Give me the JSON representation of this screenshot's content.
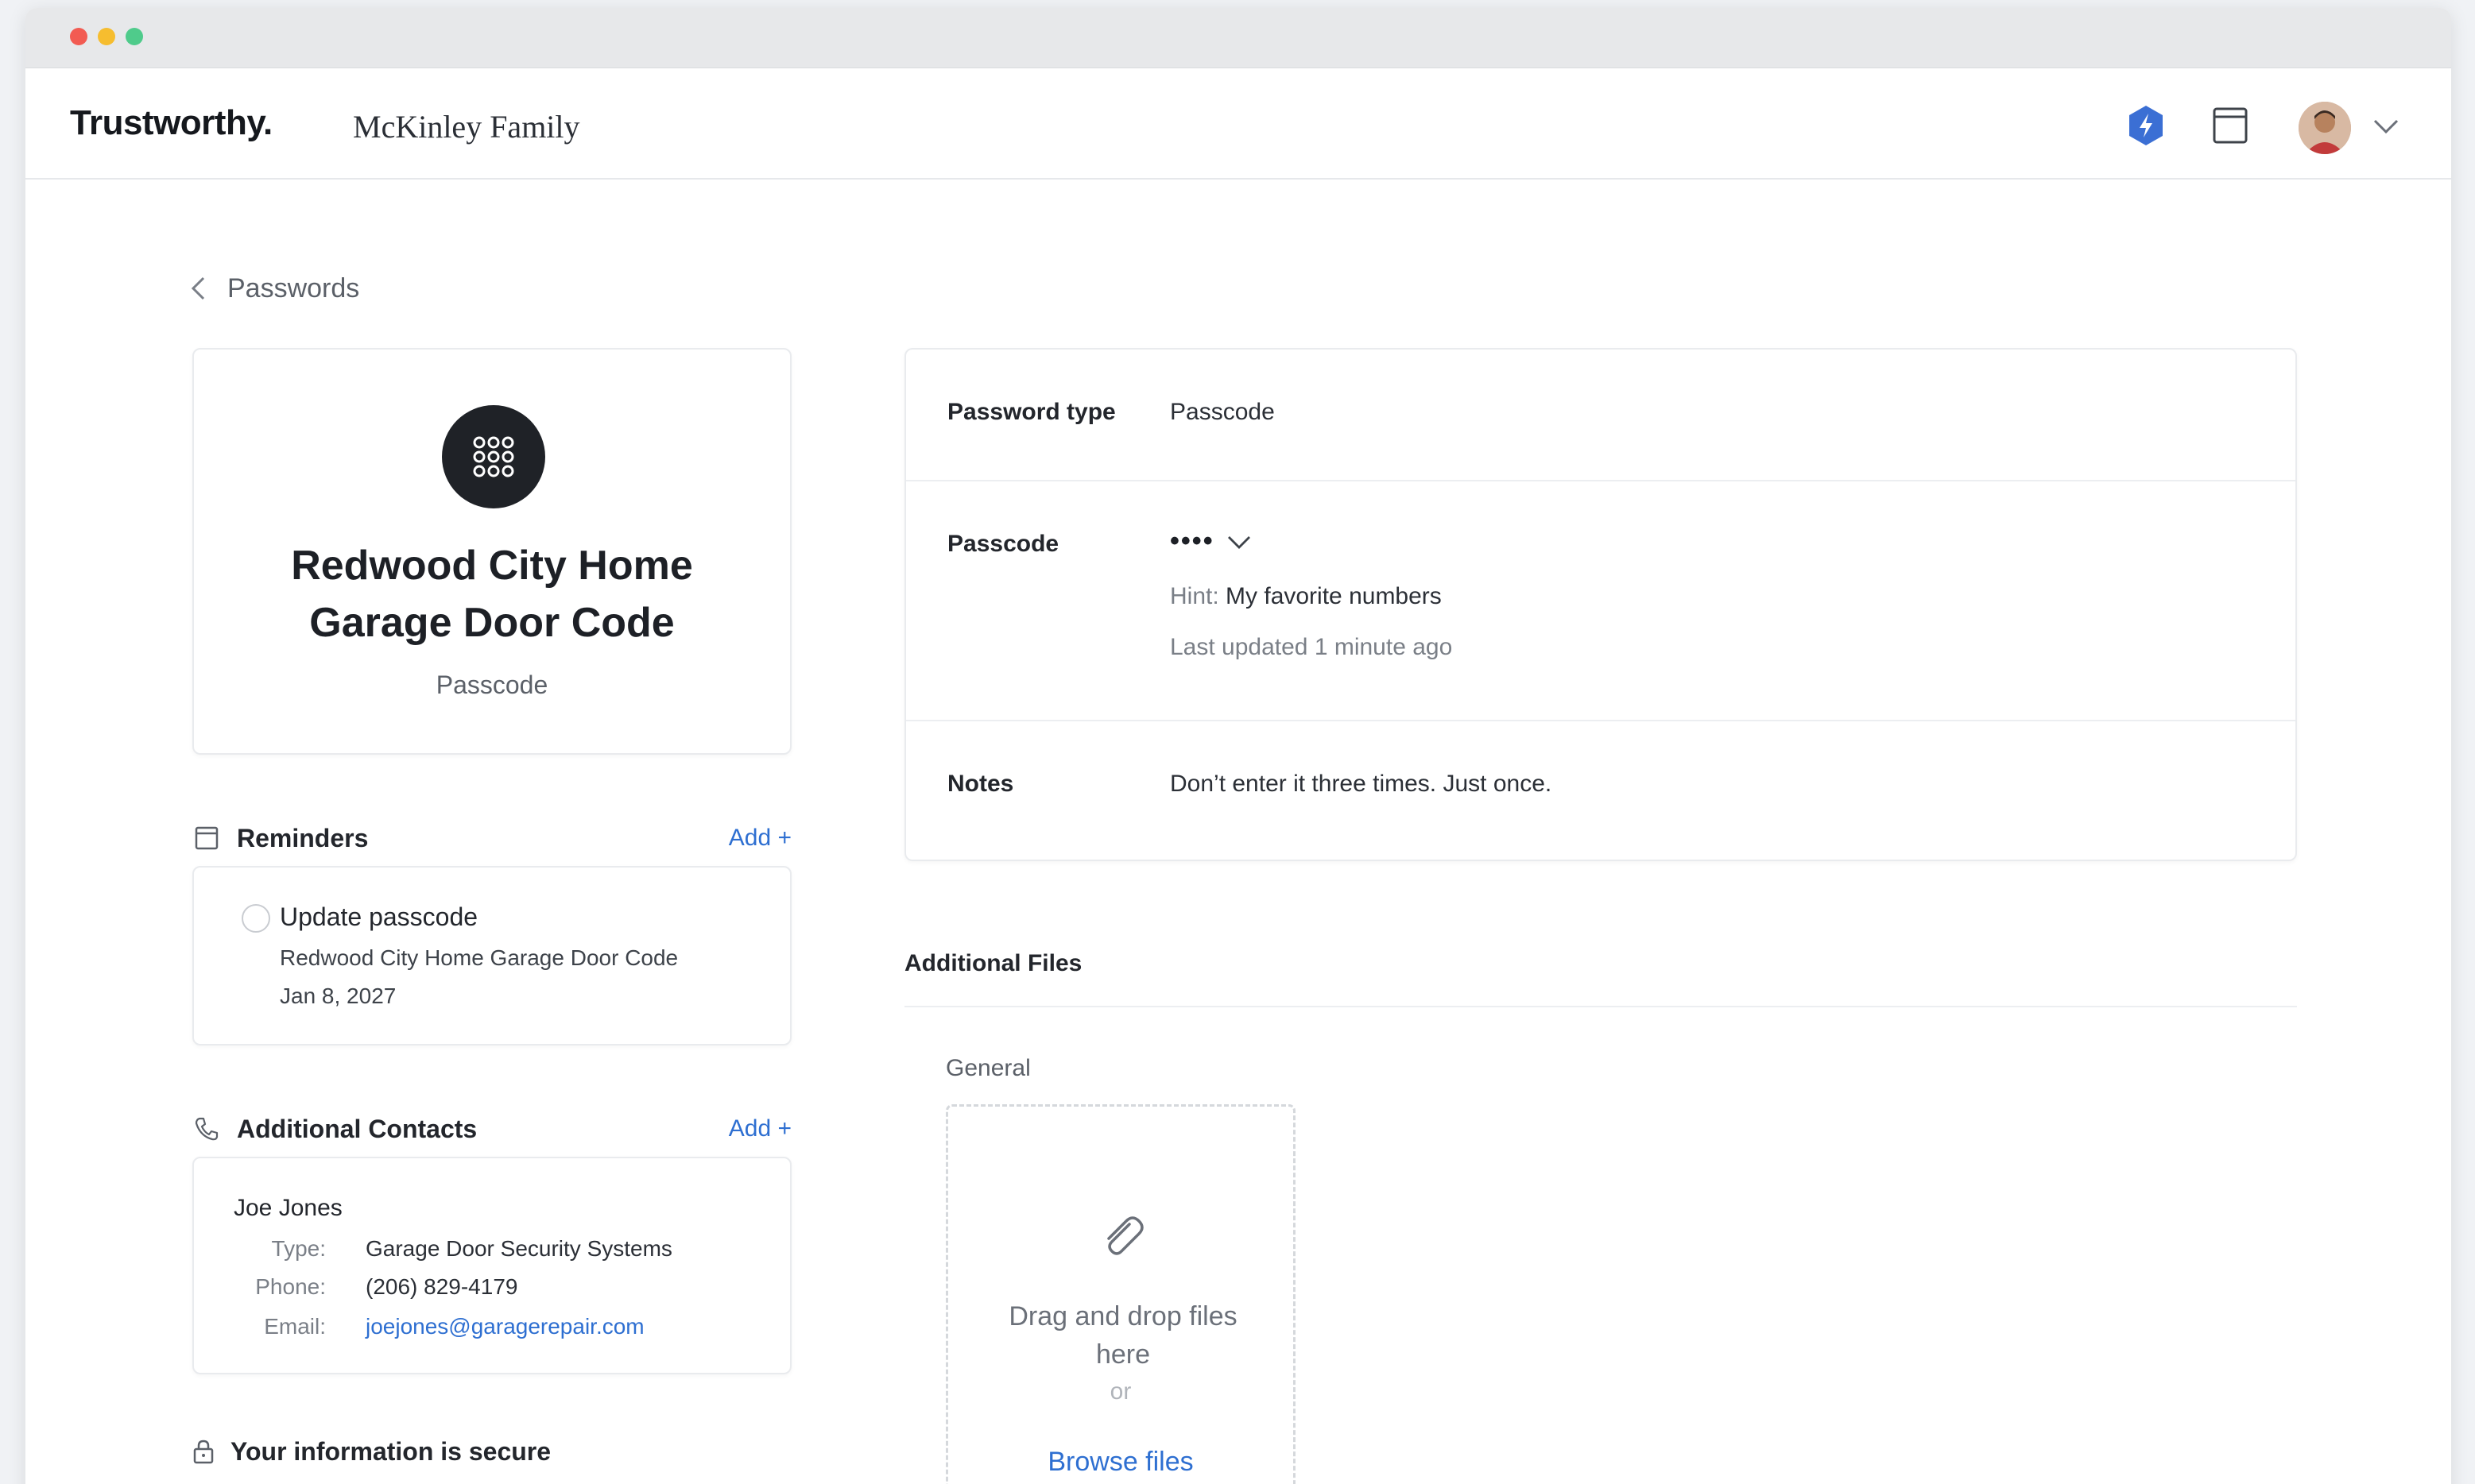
{
  "header": {
    "brand": "Trustworthy.",
    "family": "McKinley Family"
  },
  "breadcrumb": {
    "back_label": "Passwords"
  },
  "hero": {
    "title_line1": "Redwood City Home",
    "title_line2": "Garage Door Code",
    "subtitle": "Passcode"
  },
  "reminders": {
    "title": "Reminders",
    "add_label": "Add +",
    "items": [
      {
        "title": "Update passcode",
        "subtitle": "Redwood City Home Garage Door Code",
        "date": "Jan 8, 2027"
      }
    ]
  },
  "contacts": {
    "title": "Additional Contacts",
    "add_label": "Add +",
    "items": [
      {
        "name": "Joe Jones",
        "type_label": "Type:",
        "type": "Garage Door Security Systems",
        "phone_label": "Phone:",
        "phone": "(206) 829-4179",
        "email_label": "Email:",
        "email": "joejones@garagerepair.com"
      }
    ]
  },
  "secure": {
    "title": "Your information is secure"
  },
  "details": {
    "type_label": "Password type",
    "type_value": "Passcode",
    "passcode_label": "Passcode",
    "passcode_masked": "••••",
    "hint_label": "Hint:",
    "hint_value": "My favorite numbers",
    "updated": "Last updated 1 minute ago",
    "notes_label": "Notes",
    "notes_value": "Don’t enter it three times. Just once."
  },
  "files": {
    "title": "Additional Files",
    "group": "General",
    "drop_text": "Drag and drop files here",
    "or_text": "or",
    "browse_label": "Browse files"
  },
  "colors": {
    "accent": "#2e6fd1",
    "shield": "#3b6fd4"
  }
}
